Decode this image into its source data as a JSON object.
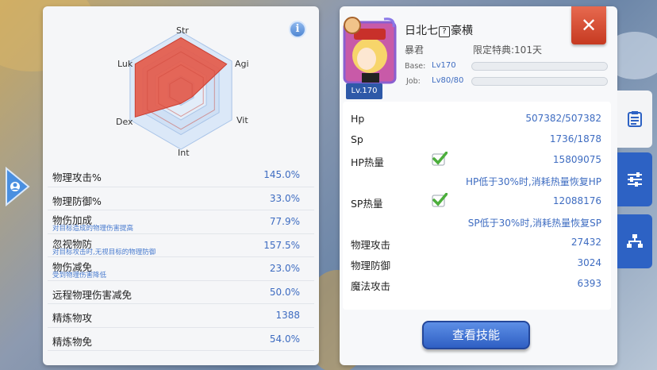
{
  "radar": {
    "labels": {
      "str": "Str",
      "agi": "Agi",
      "vit": "Vit",
      "int": "Int",
      "dex": "Dex",
      "luk": "Luk"
    },
    "values": {
      "str": 0.9,
      "agi": 0.9,
      "vit": 0.22,
      "int": 0.22,
      "dex": 0.9,
      "luk": 0.9
    },
    "fill_color": "#e45a4a"
  },
  "stats": [
    {
      "name": "物理攻击%",
      "sub": "",
      "value": "145.0%"
    },
    {
      "name": "物理防御%",
      "sub": "",
      "value": "33.0%"
    },
    {
      "name": "物伤加成",
      "sub": "对目标造成的物理伤害提高",
      "value": "77.9%"
    },
    {
      "name": "忽视物防",
      "sub": "对目标攻击时,无视目标的物理防御",
      "value": "157.5%"
    },
    {
      "name": "物伤减免",
      "sub": "受到物理伤害降低",
      "value": "23.0%"
    },
    {
      "name": "远程物理伤害减免",
      "sub": "",
      "value": "50.0%"
    },
    {
      "name": "精炼物攻",
      "sub": "",
      "value": "1388"
    },
    {
      "name": "精炼物免",
      "sub": "",
      "value": "54.0%"
    }
  ],
  "character": {
    "level_tag": "Lv.170",
    "name": "日北七",
    "name_suffix": "豪横",
    "title": "暴君",
    "limited": "限定特典:101天",
    "base_label": "Base:",
    "base_value": "Lv170",
    "job_label": "Job:",
    "job_value": "Lv80/80"
  },
  "attributes": {
    "hp": {
      "name": "Hp",
      "value": "507382/507382"
    },
    "sp": {
      "name": "Sp",
      "value": "1736/1878"
    },
    "hp_heat": {
      "name": "HP热量",
      "value": "15809075",
      "note": "HP低于30%时,消耗热量恢复HP",
      "checked": true
    },
    "sp_heat": {
      "name": "SP热量",
      "value": "12088176",
      "note": "SP低于30%时,消耗热量恢复SP",
      "checked": true
    },
    "patk": {
      "name": "物理攻击",
      "value": "27432"
    },
    "pdef": {
      "name": "物理防御",
      "value": "3024"
    },
    "matk": {
      "name": "魔法攻击",
      "value": "6393"
    }
  },
  "buttons": {
    "view_skills": "查看技能",
    "close": "✕",
    "info": "i"
  },
  "icons": {
    "tab_attrs": "list-icon",
    "tab_settings": "sliders-icon",
    "tab_tree": "hierarchy-icon",
    "left_arrow": "profile-arrow-icon"
  },
  "colors": {
    "accent_blue": "#3e6cc1",
    "close_red": "#d9472b",
    "check_green": "#4cae3c"
  }
}
